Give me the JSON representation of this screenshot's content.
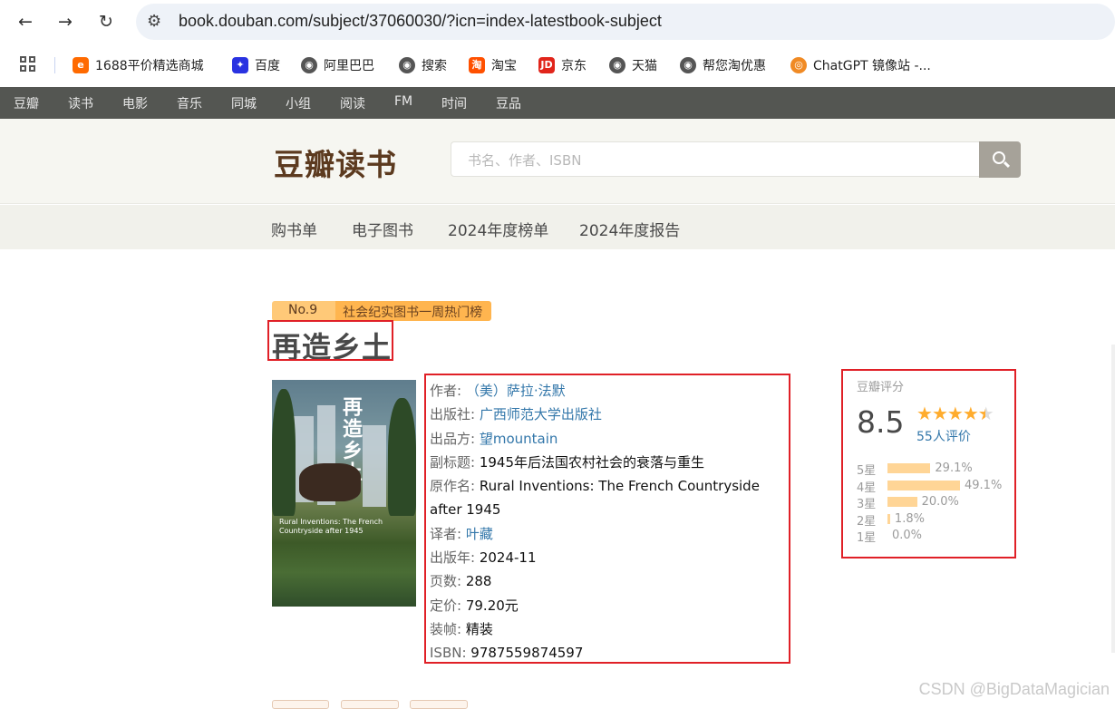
{
  "browser": {
    "url": "book.douban.com/subject/37060030/?icn=index-latestbook-subject",
    "bookmarks": [
      {
        "label": "1688平价精选商城",
        "color": "#ff6a00",
        "icon": "1688-icon"
      },
      {
        "label": "百度",
        "color": "#2932e1",
        "icon": "baidu-icon"
      },
      {
        "label": "阿里巴巴",
        "color": "#555555",
        "icon": "globe-icon"
      },
      {
        "label": "搜索",
        "color": "#555555",
        "icon": "globe-icon"
      },
      {
        "label": "淘宝",
        "color": "#ff5000",
        "icon": "taobao-icon"
      },
      {
        "label": "京东",
        "color": "#e1251b",
        "icon": "jd-icon"
      },
      {
        "label": "天猫",
        "color": "#555555",
        "icon": "globe-icon"
      },
      {
        "label": "帮您淘优惠",
        "color": "#555555",
        "icon": "globe-icon"
      },
      {
        "label": "ChatGPT 镜像站 -...",
        "color": "#f08a24",
        "icon": "chatgpt-icon"
      }
    ]
  },
  "globalnav": [
    "豆瓣",
    "读书",
    "电影",
    "音乐",
    "同城",
    "小组",
    "阅读",
    "FM",
    "时间",
    "豆品"
  ],
  "header": {
    "logo": "豆瓣读书",
    "search_placeholder": "书名、作者、ISBN"
  },
  "subnav": [
    "购书单",
    "电子图书",
    "2024年度榜单",
    "2024年度报告"
  ],
  "book": {
    "rank_no": "No.9",
    "rank_title": "社会纪实图书一周热门榜",
    "title": "再造乡土",
    "cover_title": "再造乡土",
    "cover_sub": "Rural Inventions: The French Countryside after 1945",
    "info": {
      "author_label": "作者:",
      "author": "（美）萨拉·法默",
      "publisher_label": "出版社:",
      "publisher": "广西师范大学出版社",
      "producer_label": "出品方:",
      "producer": "望mountain",
      "subtitle_label": "副标题:",
      "subtitle": "1945年后法国农村社会的衰落与重生",
      "original_label": "原作名:",
      "original": "Rural Inventions: The French Countryside after 1945",
      "translator_label": "译者:",
      "translator": "叶藏",
      "year_label": "出版年:",
      "year": "2024-11",
      "pages_label": "页数:",
      "pages": "288",
      "price_label": "定价:",
      "price": "79.20元",
      "binding_label": "装帧:",
      "binding": "精装",
      "isbn_label": "ISBN:",
      "isbn": "9787559874597"
    }
  },
  "rating": {
    "header": "豆瓣评分",
    "score": "8.5",
    "stars": 4.5,
    "count": "55人评价",
    "distribution": [
      {
        "label": "5星",
        "percent": 29.1,
        "text": "29.1%"
      },
      {
        "label": "4星",
        "percent": 49.1,
        "text": "49.1%"
      },
      {
        "label": "3星",
        "percent": 20.0,
        "text": "20.0%"
      },
      {
        "label": "2星",
        "percent": 1.8,
        "text": "1.8%"
      },
      {
        "label": "1星",
        "percent": 0.0,
        "text": "0.0%"
      }
    ]
  },
  "watermark": "CSDN @BigDataMagician"
}
